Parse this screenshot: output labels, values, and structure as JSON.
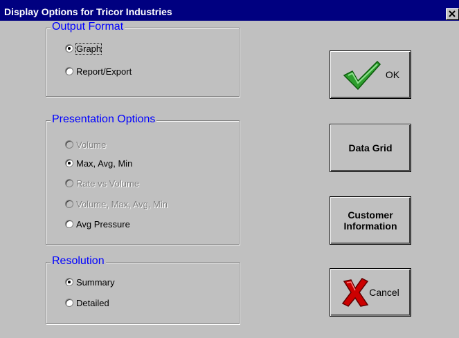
{
  "window": {
    "title": "Display Options for Tricor Industries",
    "close_label": "×"
  },
  "output_format": {
    "title": "Output Format",
    "options": [
      {
        "label": "Graph",
        "checked": true,
        "enabled": true
      },
      {
        "label": "Report/Export",
        "checked": false,
        "enabled": true
      }
    ]
  },
  "presentation": {
    "title": "Presentation Options",
    "options": [
      {
        "label": "Volume",
        "checked": false,
        "enabled": false
      },
      {
        "label": "Max, Avg, Min",
        "checked": true,
        "enabled": true
      },
      {
        "label": "Rate vs Volume",
        "checked": false,
        "enabled": false
      },
      {
        "label": "Volume, Max, Avg, Min",
        "checked": false,
        "enabled": false
      },
      {
        "label": "Avg Pressure",
        "checked": false,
        "enabled": true
      }
    ]
  },
  "resolution": {
    "title": "Resolution",
    "options": [
      {
        "label": "Summary",
        "checked": true,
        "enabled": true
      },
      {
        "label": "Detailed",
        "checked": false,
        "enabled": true
      }
    ]
  },
  "buttons": {
    "ok": {
      "label": "OK",
      "icon": "checkmark-icon",
      "icon_color": "#2e9e2e"
    },
    "data_grid": {
      "label": "Data Grid"
    },
    "customer_info": {
      "label_line1": "Customer",
      "label_line2": "Information"
    },
    "cancel": {
      "label": "Cancel",
      "icon": "x-cross-icon",
      "icon_color": "#cc0000"
    }
  }
}
